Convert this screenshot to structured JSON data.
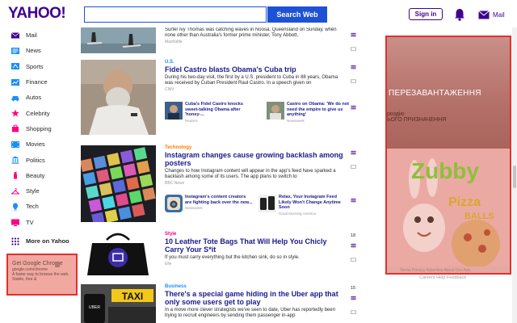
{
  "header": {
    "logo": "YAHOO!",
    "search_value": "",
    "search_button": "Search Web",
    "signin_button": "Sign in",
    "mail_label": "Mail"
  },
  "sidebar": {
    "items": [
      {
        "label": "Mail",
        "icon": "mail-icon",
        "color": "#400090"
      },
      {
        "label": "News",
        "icon": "news-icon",
        "color": "#188fff"
      },
      {
        "label": "Sports",
        "icon": "sports-icon",
        "color": "#188fff"
      },
      {
        "label": "Finance",
        "icon": "finance-icon",
        "color": "#188fff"
      },
      {
        "label": "Autos",
        "icon": "autos-icon",
        "color": "#188fff"
      },
      {
        "label": "Celebrity",
        "icon": "celebrity-icon",
        "color": "#ff0080"
      },
      {
        "label": "Shopping",
        "icon": "shopping-icon",
        "color": "#ff0080"
      },
      {
        "label": "Movies",
        "icon": "movies-icon",
        "color": "#188fff"
      },
      {
        "label": "Politics",
        "icon": "politics-icon",
        "color": "#188fff"
      },
      {
        "label": "Beauty",
        "icon": "beauty-icon",
        "color": "#ff0080"
      },
      {
        "label": "Style",
        "icon": "style-icon",
        "color": "#ff0080"
      },
      {
        "label": "Tech",
        "icon": "tech-icon",
        "color": "#188fff"
      },
      {
        "label": "TV",
        "icon": "tv-icon",
        "color": "#ff0080"
      }
    ],
    "more": "More on Yahoo"
  },
  "left_ad": {
    "title": "Get Google Chrome",
    "domain": "google.com/chrome",
    "text": "A faster way to browse the web. Stable, free &"
  },
  "stories": [
    {
      "category": "",
      "headline": "",
      "summary": "Surfer Ivy Thomas was catching waves in Noosa, Queensland on Sunday, when none other than Australia's former prime minister, Tony Abbott,",
      "source": "Mashable"
    },
    {
      "category": "U.S.",
      "category_color": "#188fff",
      "headline": "Fidel Castro blasts Obama's Cuba trip",
      "summary": "During his two-day visit, the first by a U.S. president to Cuba in 88 years, Obama was received by Cuban President Raul Castro. In a speech given on",
      "source": "CNN",
      "related": [
        {
          "headline": "Cuba's Fidel Castro knocks sweet-talking Obama after 'honey-...",
          "source": "Reuters"
        },
        {
          "headline": "Castro on Obama: 'We do not need the empire to give us anything'",
          "source": "Newsweek"
        }
      ]
    },
    {
      "category": "Technology",
      "category_color": "#ff7a00",
      "headline": "Instagram changes cause growing backlash among posters",
      "summary": "Changes to how Instagram content will appear in the app's feed have sparked a backlash among some of its users. The app plans to switch to",
      "source": "BBC News",
      "related": [
        {
          "headline": "Instagram's content creators are fighting back over the new...",
          "source": "Newsweek"
        },
        {
          "headline": "Relax, Your Instagram Feed Likely Won't Change Anytime Soon",
          "source": "Good Morning America"
        }
      ]
    },
    {
      "category": "Style",
      "category_color": "#ff0080",
      "headline": "10 Leather Tote Bags That Will Help You Chicly Carry Your S*it",
      "summary": "If you must carry everything but the kitchen sink, do so in style.",
      "source": "Elle",
      "count": "18"
    },
    {
      "category": "Business",
      "category_color": "#188fff",
      "headline": "There's a special game hiding in the Uber app that only some users get to play",
      "summary": "In a move more clever strategists we've seen to date, Uber has reportedly been trying to recruit engineers by sending them passenger in-app",
      "source": "",
      "count": "15"
    }
  ],
  "right_ad": {
    "title": "ПЕРЕЗАВАНТАЖЕННЯ",
    "subtitle_1": "роздію",
    "subtitle_2": "ЬОГО ПРИЗНАЧЕННЯ",
    "game_title": "Zubby",
    "game_sub1": "Pizza",
    "game_sub2": "BALLS",
    "footer": "Terms Privacy Advertise About Our Ads",
    "links": "Careers  Help  Feedback"
  }
}
